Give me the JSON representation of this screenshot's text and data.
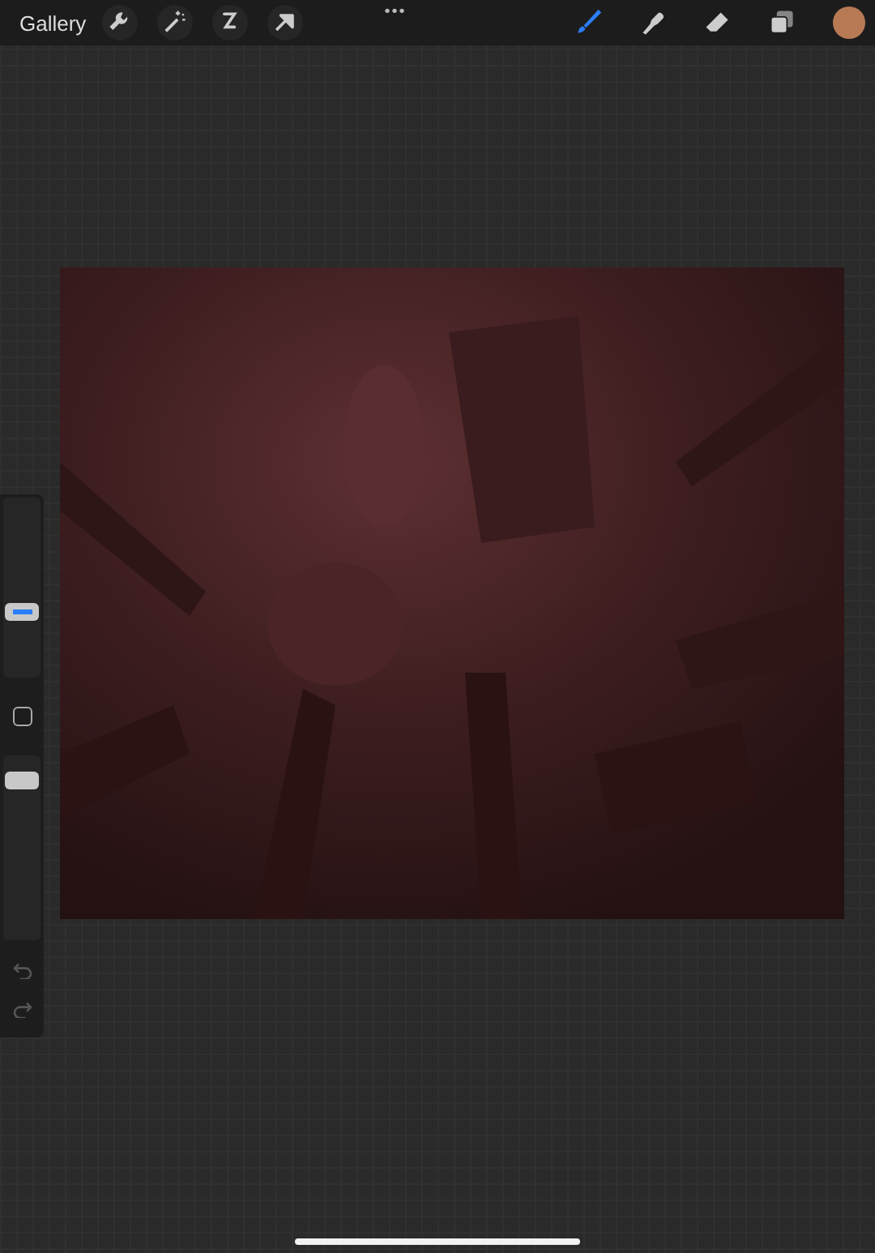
{
  "toolbar": {
    "gallery": "Gallery",
    "more": "•••",
    "left_tools": [
      {
        "kind": "wrench",
        "selected": false
      },
      {
        "kind": "wand",
        "selected": false
      },
      {
        "kind": "selection",
        "selected": false
      },
      {
        "kind": "arrow",
        "selected": false
      }
    ],
    "right_tools": [
      {
        "kind": "brush",
        "selected": true
      },
      {
        "kind": "smudge",
        "selected": false
      },
      {
        "kind": "eraser",
        "selected": false
      },
      {
        "kind": "layers",
        "selected": false
      }
    ],
    "color": "#b87a55"
  },
  "sidebar": {
    "size": {
      "level": 0.35
    },
    "opacity": {
      "level": 0.9
    }
  }
}
